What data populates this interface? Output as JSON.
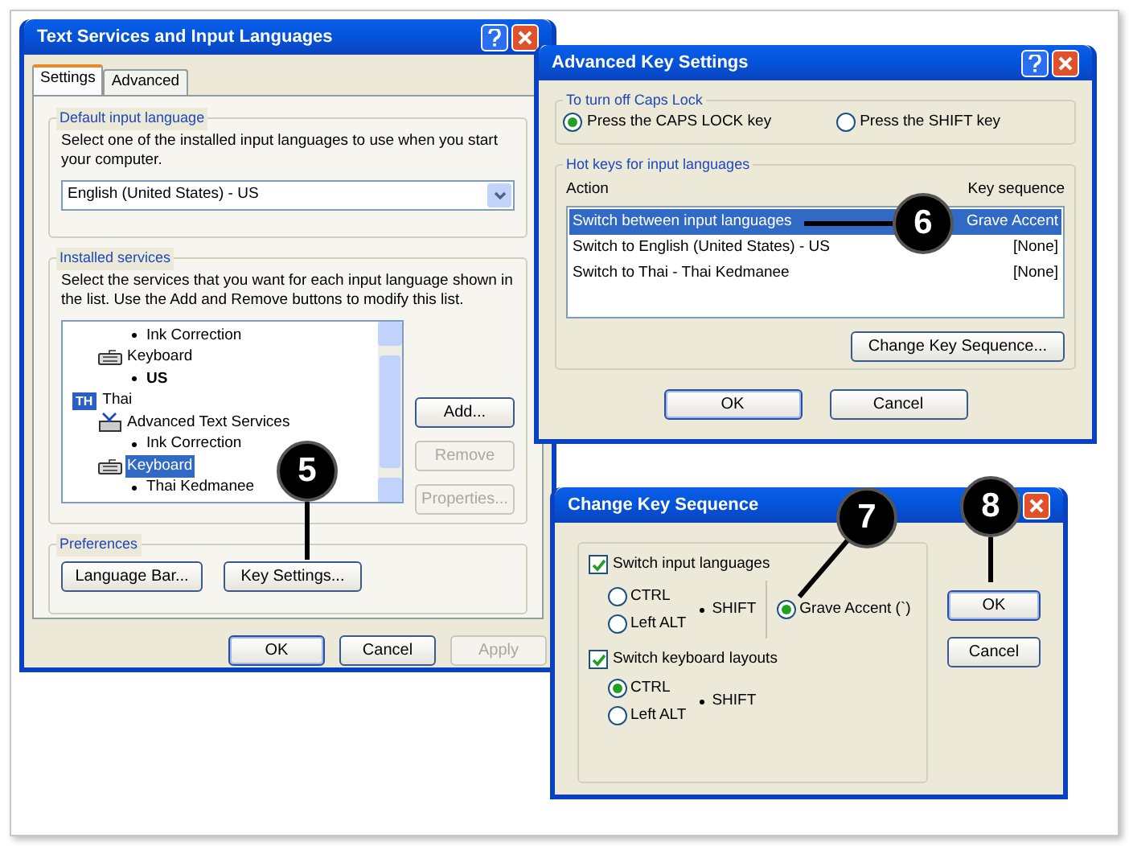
{
  "text_services_window": {
    "title": "Text Services and Input Languages",
    "tabs": [
      {
        "label": "Settings",
        "selected": true
      },
      {
        "label": "Advanced",
        "selected": false
      }
    ],
    "default_language": {
      "legend": "Default input language",
      "description": "Select one of the installed input languages to use when you start your computer.",
      "dropdown_value": "English (United States) - US"
    },
    "installed_services": {
      "legend": "Installed services",
      "description": "Select the services that you want for each input language shown in the list. Use the Add and Remove buttons to modify this list.",
      "tree": [
        {
          "kind": "bullet",
          "label": "Ink Correction",
          "selected": false
        },
        {
          "kind": "keyboard",
          "label": "Keyboard",
          "selected": false,
          "children": [
            {
              "kind": "bullet",
              "label": "US",
              "selected": false,
              "default": true
            }
          ]
        },
        {
          "kind": "language",
          "badge": "TH",
          "label": "Thai",
          "selected": false,
          "children": [
            {
              "kind": "services",
              "label": "Advanced Text Services",
              "selected": false,
              "children": [
                {
                  "kind": "bullet",
                  "label": "Ink Correction",
                  "selected": false
                }
              ]
            },
            {
              "kind": "keyboard",
              "label": "Keyboard",
              "selected": true,
              "children": [
                {
                  "kind": "bullet",
                  "label": "Thai Kedmanee",
                  "selected": false
                }
              ]
            }
          ]
        }
      ],
      "buttons": [
        {
          "label": "Add...",
          "disabled": false
        },
        {
          "label": "Remove",
          "disabled": true
        },
        {
          "label": "Properties...",
          "disabled": true
        }
      ]
    },
    "preferences": {
      "legend": "Preferences",
      "buttons": [
        {
          "label": "Language Bar...",
          "disabled": false
        },
        {
          "label": "Key Settings...",
          "disabled": false
        }
      ]
    },
    "footer_buttons": [
      {
        "label": "OK",
        "disabled": false
      },
      {
        "label": "Cancel",
        "disabled": false
      },
      {
        "label": "Apply",
        "disabled": true
      }
    ]
  },
  "advanced_key_window": {
    "title": "Advanced Key Settings",
    "caps_lock": {
      "legend": "To turn off Caps Lock",
      "options": [
        {
          "label": "Press the CAPS LOCK key",
          "selected": true
        },
        {
          "label": "Press the SHIFT key",
          "selected": false
        }
      ]
    },
    "hotkeys": {
      "legend": "Hot keys for input languages",
      "columns": [
        "Action",
        "Key sequence"
      ],
      "rows": [
        {
          "action": "Switch between input languages",
          "key": "Grave Accent",
          "selected": true
        },
        {
          "action": "Switch to English (United States) - US",
          "key": "[None]",
          "selected": false
        },
        {
          "action": "Switch to Thai - Thai Kedmanee",
          "key": "[None]",
          "selected": false
        }
      ],
      "button": "Change Key Sequence..."
    },
    "footer_buttons": [
      {
        "label": "OK",
        "disabled": false
      },
      {
        "label": "Cancel",
        "disabled": false
      }
    ]
  },
  "change_key_window": {
    "title": "Change Key Sequence",
    "groups": [
      {
        "label": "Switch input languages",
        "checked": true,
        "modifiers": [
          {
            "label": "CTRL",
            "selected": false
          },
          {
            "label": "Left ALT",
            "selected": false
          }
        ],
        "plus": "SHIFT",
        "alternative": {
          "label": "Grave Accent (`)",
          "selected": true
        }
      },
      {
        "label": "Switch keyboard layouts",
        "checked": true,
        "modifiers": [
          {
            "label": "CTRL",
            "selected": true
          },
          {
            "label": "Left ALT",
            "selected": false
          }
        ],
        "plus": "SHIFT"
      }
    ],
    "buttons": [
      {
        "label": "OK",
        "disabled": false
      },
      {
        "label": "Cancel",
        "disabled": false
      }
    ]
  },
  "callouts": [
    {
      "number": "5"
    },
    {
      "number": "6"
    },
    {
      "number": "7"
    },
    {
      "number": "8"
    }
  ]
}
